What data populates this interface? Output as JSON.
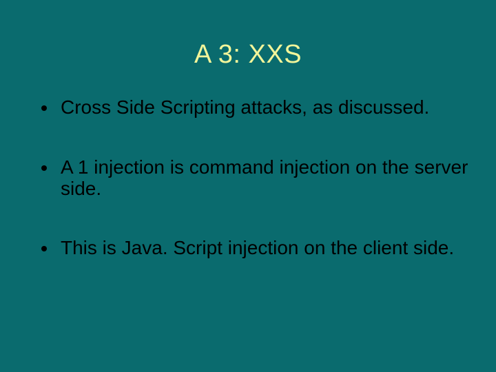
{
  "title": "A 3: XXS",
  "bullets": [
    "Cross Side Scripting attacks, as discussed.",
    "A 1 injection is command injection on the server side.",
    "This is Java. Script injection on the client side."
  ]
}
